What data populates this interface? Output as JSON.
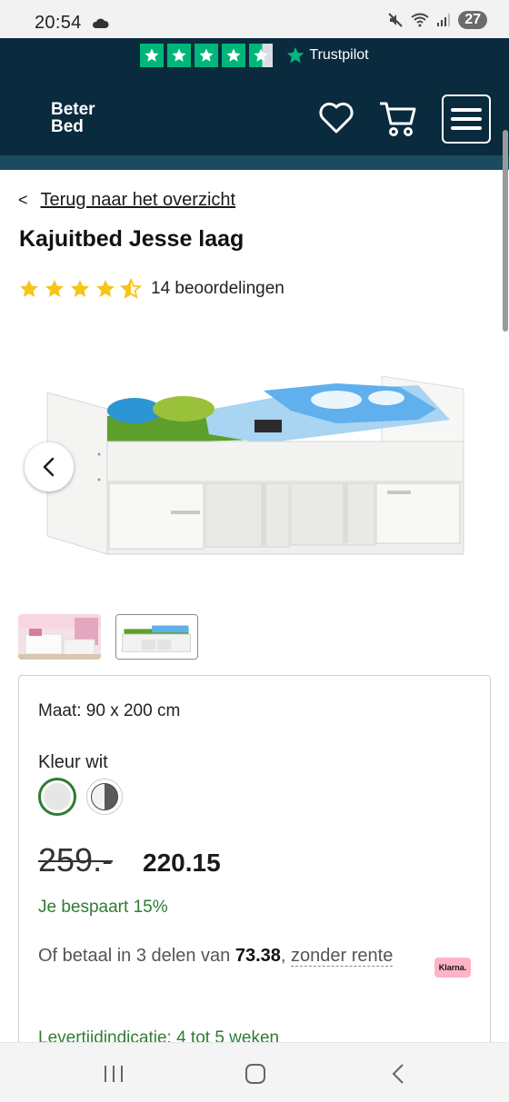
{
  "status_bar": {
    "time": "20:54",
    "battery": "27"
  },
  "trustpilot": {
    "label": "Trustpilot",
    "rating_stars": 4.5
  },
  "header": {
    "logo_line1": "Beter",
    "logo_line2": "Bed"
  },
  "back_link": "Terug naar het overzicht",
  "product": {
    "title": "Kajuitbed Jesse laag",
    "rating": 4.5,
    "reviews": "14 beoordelingen",
    "size_label": "Maat: 90 x 200 cm",
    "color_label": "Kleur wit",
    "old_price": "259.-",
    "new_price": "220.15",
    "savings": "Je bespaart 15%",
    "installments_prefix": "Of betaal in 3 delen van",
    "installments_amount": "73.38",
    "installments_sep": ",",
    "installments_link": "zonder rente",
    "klarna_badge": "Klarna.",
    "delivery": "Levertijdindicatie: 4 tot 5 weken"
  },
  "colors": {
    "header_bg": "#0a2a3d",
    "trustpilot_green": "#00b67a",
    "accent_green": "#2e7d32",
    "star_yellow": "#f5c518"
  }
}
